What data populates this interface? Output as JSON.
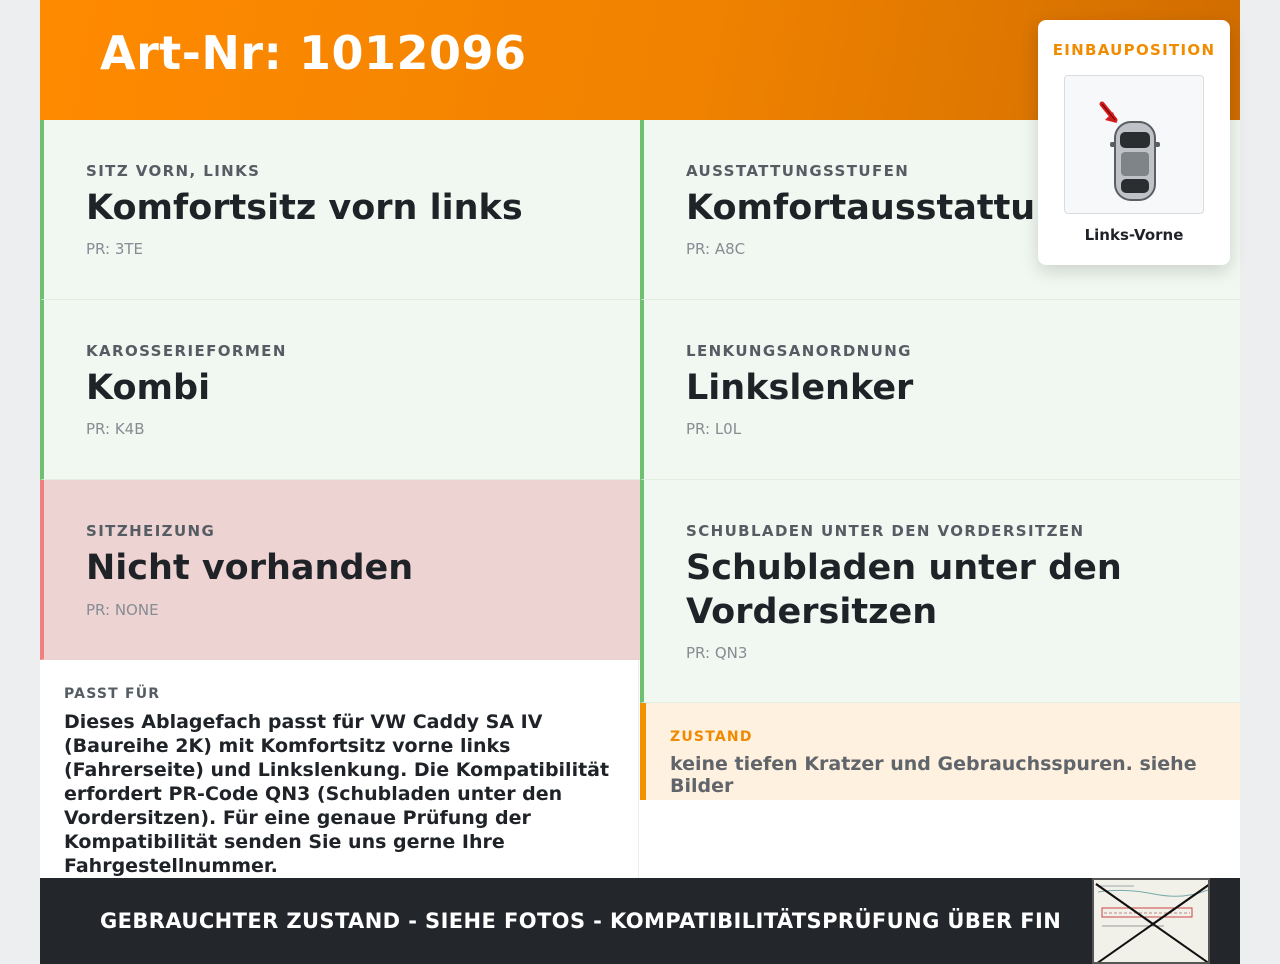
{
  "header": {
    "title": "Art-Nr: 1012096"
  },
  "cells": [
    {
      "label": "SITZ VORN, LINKS",
      "value": "Komfortsitz vorn links",
      "pr": "PR: 3TE"
    },
    {
      "label": "AUSSTATTUNGSSTUFEN",
      "value": "Komfortausstattung",
      "pr": "PR: A8C"
    },
    {
      "label": "KAROSSERIEFORMEN",
      "value": "Kombi",
      "pr": "PR: K4B"
    },
    {
      "label": "LENKUNGSANORDNUNG",
      "value": "Linkslenker",
      "pr": "PR: L0L"
    },
    {
      "label": "SITZHEIZUNG",
      "value": "Nicht vorhanden",
      "pr": "PR: NONE"
    },
    {
      "label": "SCHUBLADEN UNTER DEN VORDERSITZEN",
      "value": "Schubladen unter den Vordersitzen",
      "pr": "PR: QN3"
    }
  ],
  "passt": {
    "label": "PASST FÜR",
    "text": "Dieses Ablagefach passt für VW Caddy SA IV (Baureihe 2K) mit Komfortsitz vorne links (Fahrerseite) und Linkslenkung. Die Kompatibilität erfordert PR-Code QN3 (Schubladen unter den Vordersitzen). Für eine genaue Prüfung der Kompatibilität senden Sie uns gerne Ihre Fahrgestellnummer."
  },
  "zustand": {
    "label": "ZUSTAND",
    "text": "keine tiefen Kratzer und Gebrauchsspuren. siehe Bilder"
  },
  "footer": {
    "text": "GEBRAUCHTER ZUSTAND - SIEHE FOTOS - KOMPATIBILITÄTSPRÜFUNG ÜBER FIN"
  },
  "popup": {
    "title": "EINBAUPOSITION",
    "caption": "Links-Vorne",
    "icon": "car-top-view-icon"
  },
  "colors": {
    "accent": "#ff8a00",
    "green": "#6cc070",
    "red": "#f08080",
    "footer": "#23262b"
  }
}
